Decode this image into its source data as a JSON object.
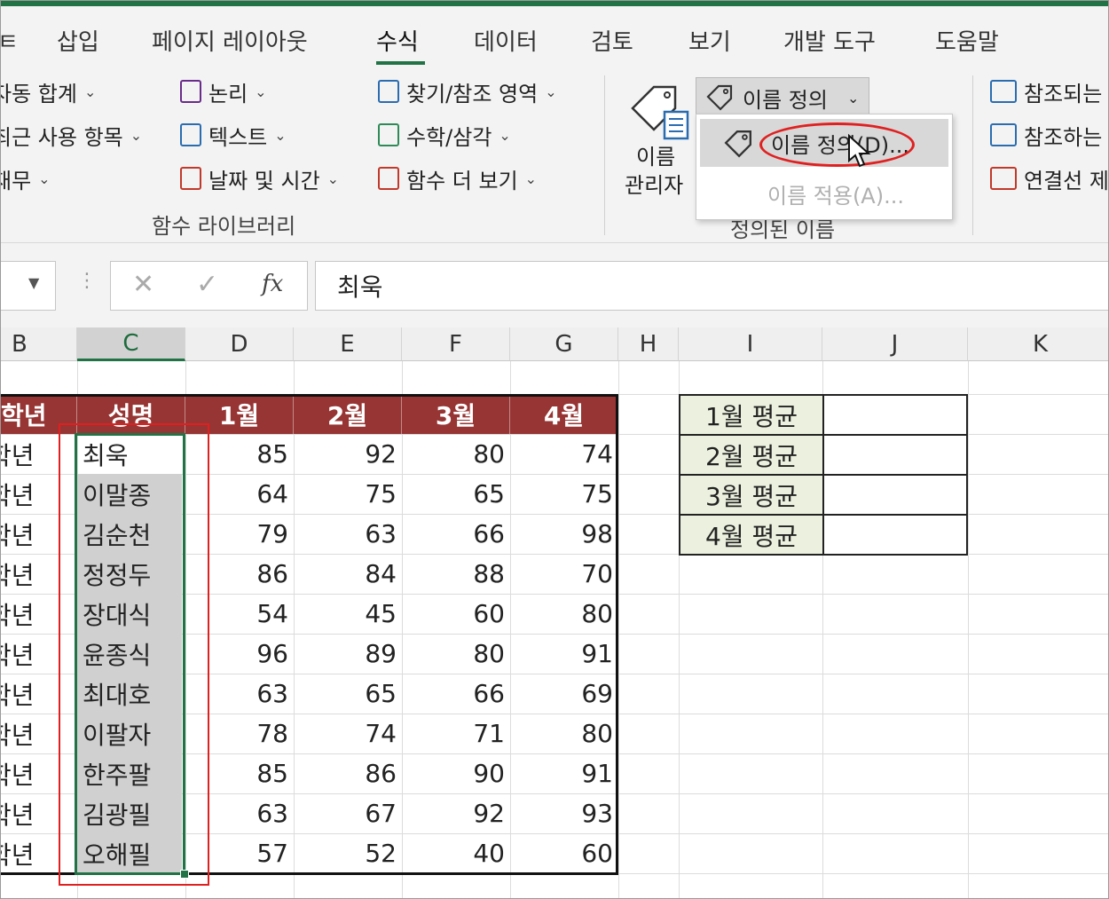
{
  "ribbon": {
    "tabs": [
      "삽입",
      "페이지 레이아웃",
      "수식",
      "데이터",
      "검토",
      "보기",
      "개발 도구",
      "도움말"
    ],
    "tab_partial": "ㅌ",
    "library": {
      "items": [
        "자동 합계",
        "최근 사용 항목",
        "재무",
        "논리",
        "텍스트",
        "날짜 및 시간",
        "찾기/참조 영역",
        "수학/삼각",
        "함수 더 보기"
      ],
      "group_label": "함수 라이브러리"
    },
    "name_manager": {
      "line1": "이름",
      "line2": "관리자"
    },
    "define_name": {
      "button_label": "이름 정의",
      "group_label": "정의된 이름"
    },
    "dropdown": {
      "define_name": "이름 정의(D)...",
      "apply_name": "이름 적용(A)..."
    },
    "audit": [
      "참조되는",
      "참조하는",
      "연결선 제"
    ]
  },
  "formula_bar": {
    "value": "최욱",
    "cancel": "✕",
    "enter": "✓",
    "fx": "fx"
  },
  "columns": [
    "B",
    "C",
    "D",
    "E",
    "F",
    "G",
    "H",
    "I",
    "J",
    "K"
  ],
  "table": {
    "headers": [
      "학년",
      "성명",
      "1월",
      "2월",
      "3월",
      "4월"
    ],
    "rows": [
      [
        "학년",
        "최욱",
        "85",
        "92",
        "80",
        "74"
      ],
      [
        "학년",
        "이말종",
        "64",
        "75",
        "65",
        "75"
      ],
      [
        "학년",
        "김순천",
        "79",
        "63",
        "66",
        "98"
      ],
      [
        "학년",
        "정정두",
        "86",
        "84",
        "88",
        "70"
      ],
      [
        "학년",
        "장대식",
        "54",
        "45",
        "60",
        "80"
      ],
      [
        "학년",
        "윤종식",
        "96",
        "89",
        "80",
        "91"
      ],
      [
        "학년",
        "최대호",
        "63",
        "65",
        "66",
        "69"
      ],
      [
        "학년",
        "이팔자",
        "78",
        "74",
        "71",
        "80"
      ],
      [
        "학년",
        "한주팔",
        "85",
        "86",
        "90",
        "91"
      ],
      [
        "학년",
        "김광필",
        "63",
        "67",
        "92",
        "93"
      ],
      [
        "학년",
        "오해필",
        "57",
        "52",
        "40",
        "60"
      ]
    ]
  },
  "averages": [
    "1월 평균",
    "2월 평균",
    "3월 평균",
    "4월 평균"
  ],
  "colors": {
    "accent": "#217346",
    "header_fill": "#963534",
    "avg_fill": "#ebf1de",
    "selection_border": "#e02020"
  }
}
